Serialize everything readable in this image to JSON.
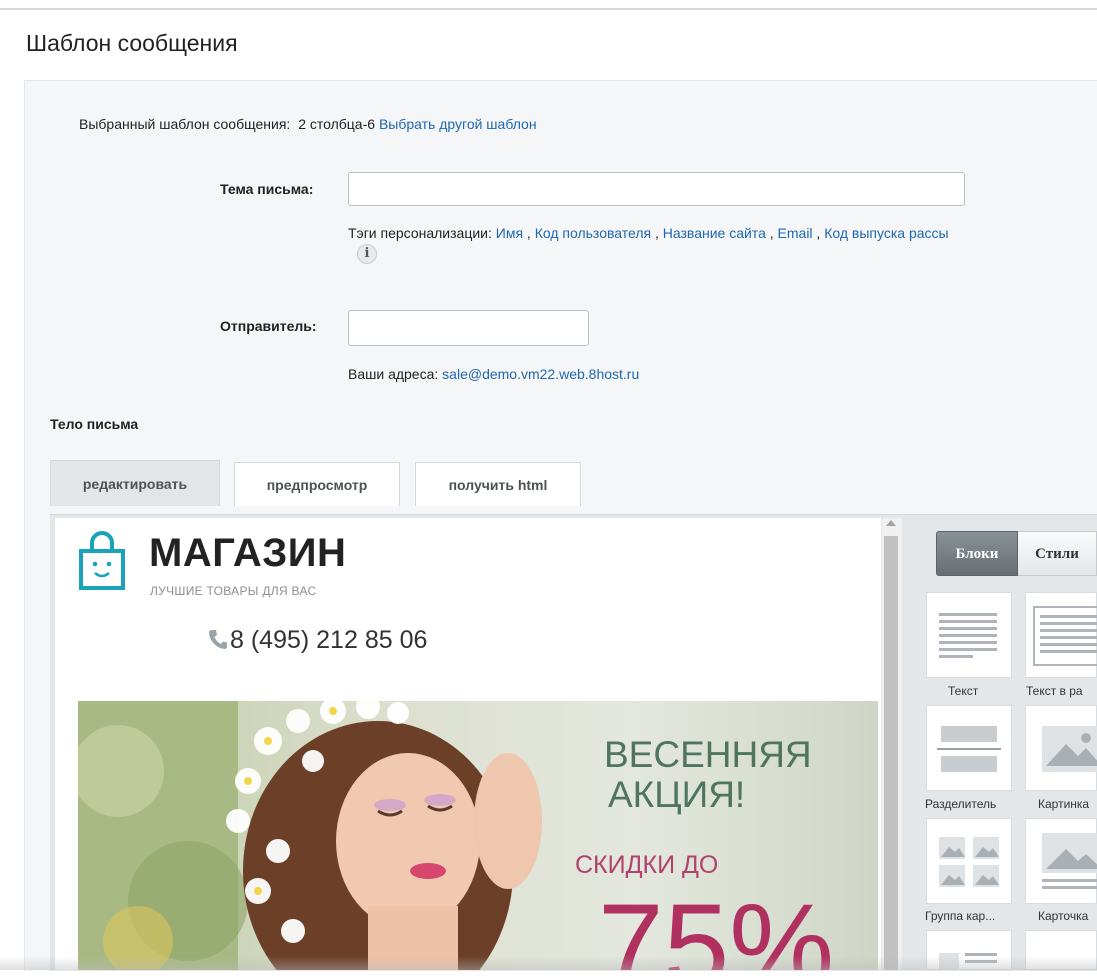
{
  "page": {
    "title": "Шаблон сообщения"
  },
  "template_row": {
    "label": "Выбранный шаблон сообщения:",
    "value": "2 столбца-6",
    "change_link": "Выбрать другой шаблон"
  },
  "subject": {
    "label": "Тема письма:",
    "value": "",
    "tags_label": "Тэги персонализации:",
    "tags": [
      "Имя",
      "Код пользователя",
      "Название сайта",
      "Email",
      "Код выпуска рассы"
    ],
    "separator": " , "
  },
  "sender": {
    "label": "Отправитель:",
    "value": "",
    "addresses_label": "Ваши адреса:",
    "address": "sale@demo.vm22.web.8host.ru"
  },
  "body": {
    "title": "Тело письма",
    "tabs": [
      "редактировать",
      "предпросмотр",
      "получить html"
    ],
    "active_tab": 0
  },
  "preview": {
    "brand": "МАГАЗИН",
    "tagline": "ЛУЧШИЕ ТОВАРЫ ДЛЯ ВАС",
    "phone": "8 (495) 212 85 06",
    "promo": {
      "line1": "ВЕСЕННЯЯ",
      "line2": "АКЦИЯ!",
      "sub": "СКИДКИ ДО",
      "big": "75%"
    }
  },
  "sidebar": {
    "buttons": [
      "Блоки",
      "Стили"
    ],
    "tiles": [
      {
        "label": "Текст",
        "icon": "text-block-icon"
      },
      {
        "label": "Текст в ра",
        "icon": "framed-text-icon"
      },
      {
        "label": "Разделитель",
        "icon": "divider-icon"
      },
      {
        "label": "Картинка",
        "icon": "image-icon"
      },
      {
        "label": "Группа кар...",
        "icon": "image-group-icon"
      },
      {
        "label": "Карточка",
        "icon": "card-icon"
      }
    ]
  },
  "colors": {
    "link": "#2067b0",
    "accent_teal": "#1aa3b8",
    "promo_green": "#4f7560",
    "promo_red": "#b0305f"
  }
}
